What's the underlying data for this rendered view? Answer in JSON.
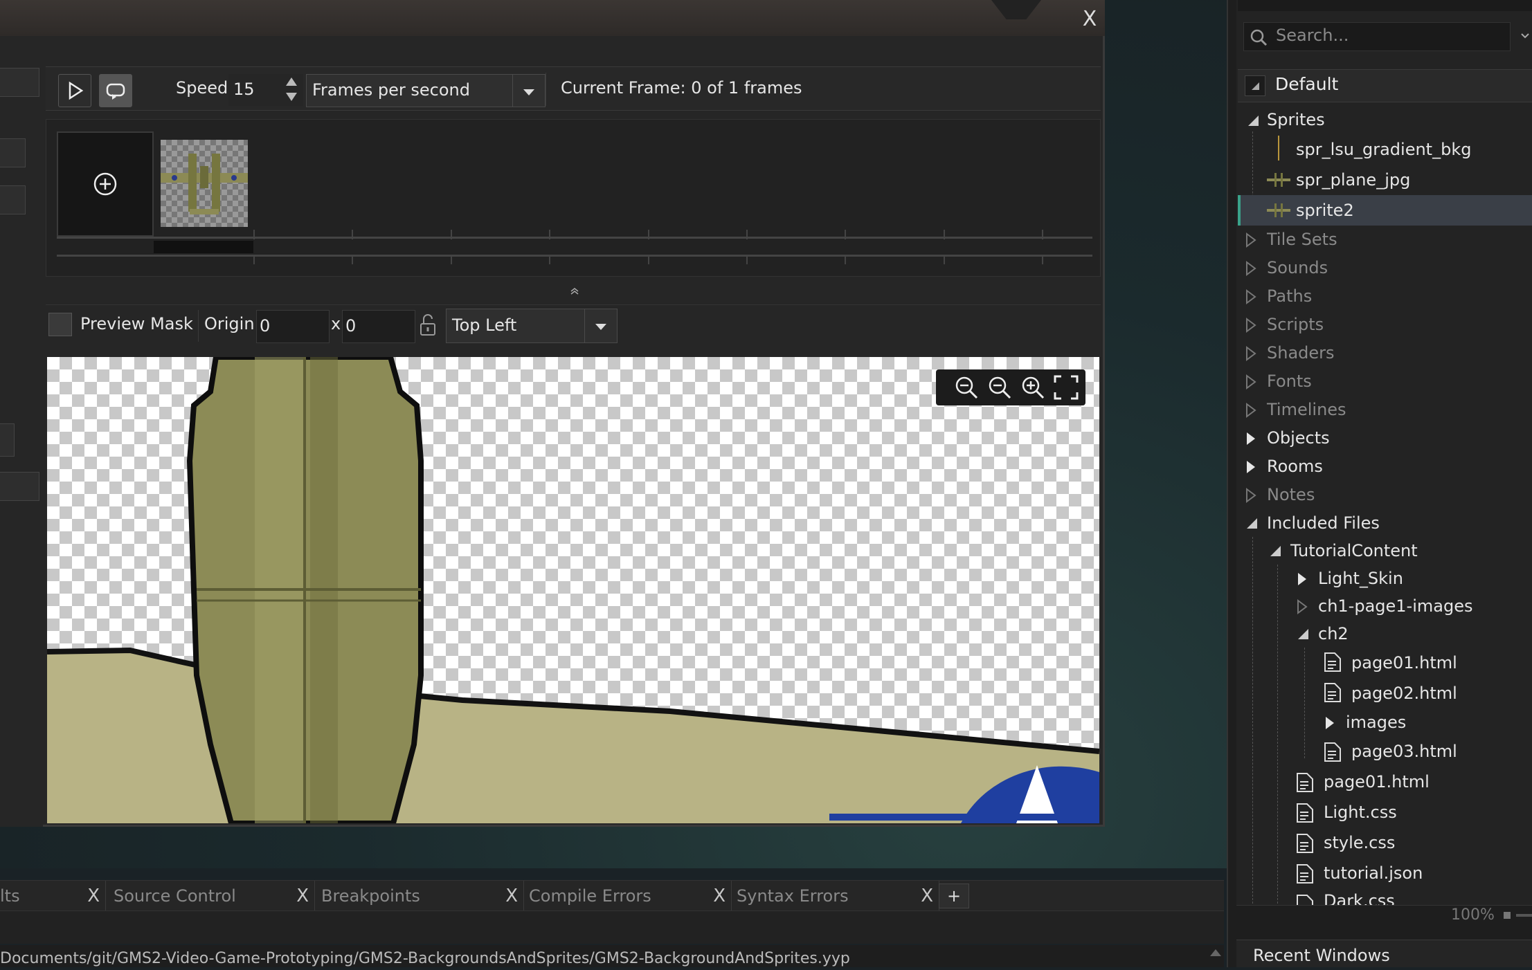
{
  "editor": {
    "close_label": "X",
    "toolbar": {
      "speed_label": "Speed:",
      "speed_value": "15",
      "speed_unit": "Frames per second",
      "current_frame": "Current Frame: 0 of 1 frames"
    },
    "origin_row": {
      "preview_mask_label": "Preview Mask",
      "origin_label": "Origin:",
      "origin_x": "0",
      "origin_sep": "x",
      "origin_y": "0",
      "origin_preset": "Top Left"
    }
  },
  "output_tabs": [
    {
      "label": "lts"
    },
    {
      "label": "Source Control"
    },
    {
      "label": "Breakpoints"
    },
    {
      "label": "Compile Errors"
    },
    {
      "label": "Syntax Errors"
    }
  ],
  "output_tab_close": "X",
  "output_tab_add": "+",
  "status_path": "Documents/git/GMS2-Video-Game-Prototyping/GMS2-BackgroundsAndSprites/GMS2-BackgroundAndSprites.yyp",
  "resources": {
    "search_placeholder": "Search...",
    "default_label": "Default",
    "sprites_label": "Sprites",
    "sprites": [
      "spr_lsu_gradient_bkg",
      "spr_plane_jpg",
      "sprite2"
    ],
    "groups": [
      "Tile Sets",
      "Sounds",
      "Paths",
      "Scripts",
      "Shaders",
      "Fonts",
      "Timelines",
      "Objects",
      "Rooms",
      "Notes"
    ],
    "included_files_label": "Included Files",
    "tutorial_content_label": "TutorialContent",
    "light_skin": "Light_Skin",
    "ch1_images": "ch1-page1-images",
    "ch2": "ch2",
    "ch2_files": [
      "page01.html",
      "page02.html",
      "images",
      "page03.html"
    ],
    "root_files": [
      "page01.html",
      "Light.css",
      "style.css",
      "tutorial.json",
      "Dark.css"
    ],
    "zoom_readout": "100%",
    "recent_windows": "Recent Windows"
  },
  "colors": {
    "selection": "#3a3f47",
    "accent": "#3aa38a"
  }
}
